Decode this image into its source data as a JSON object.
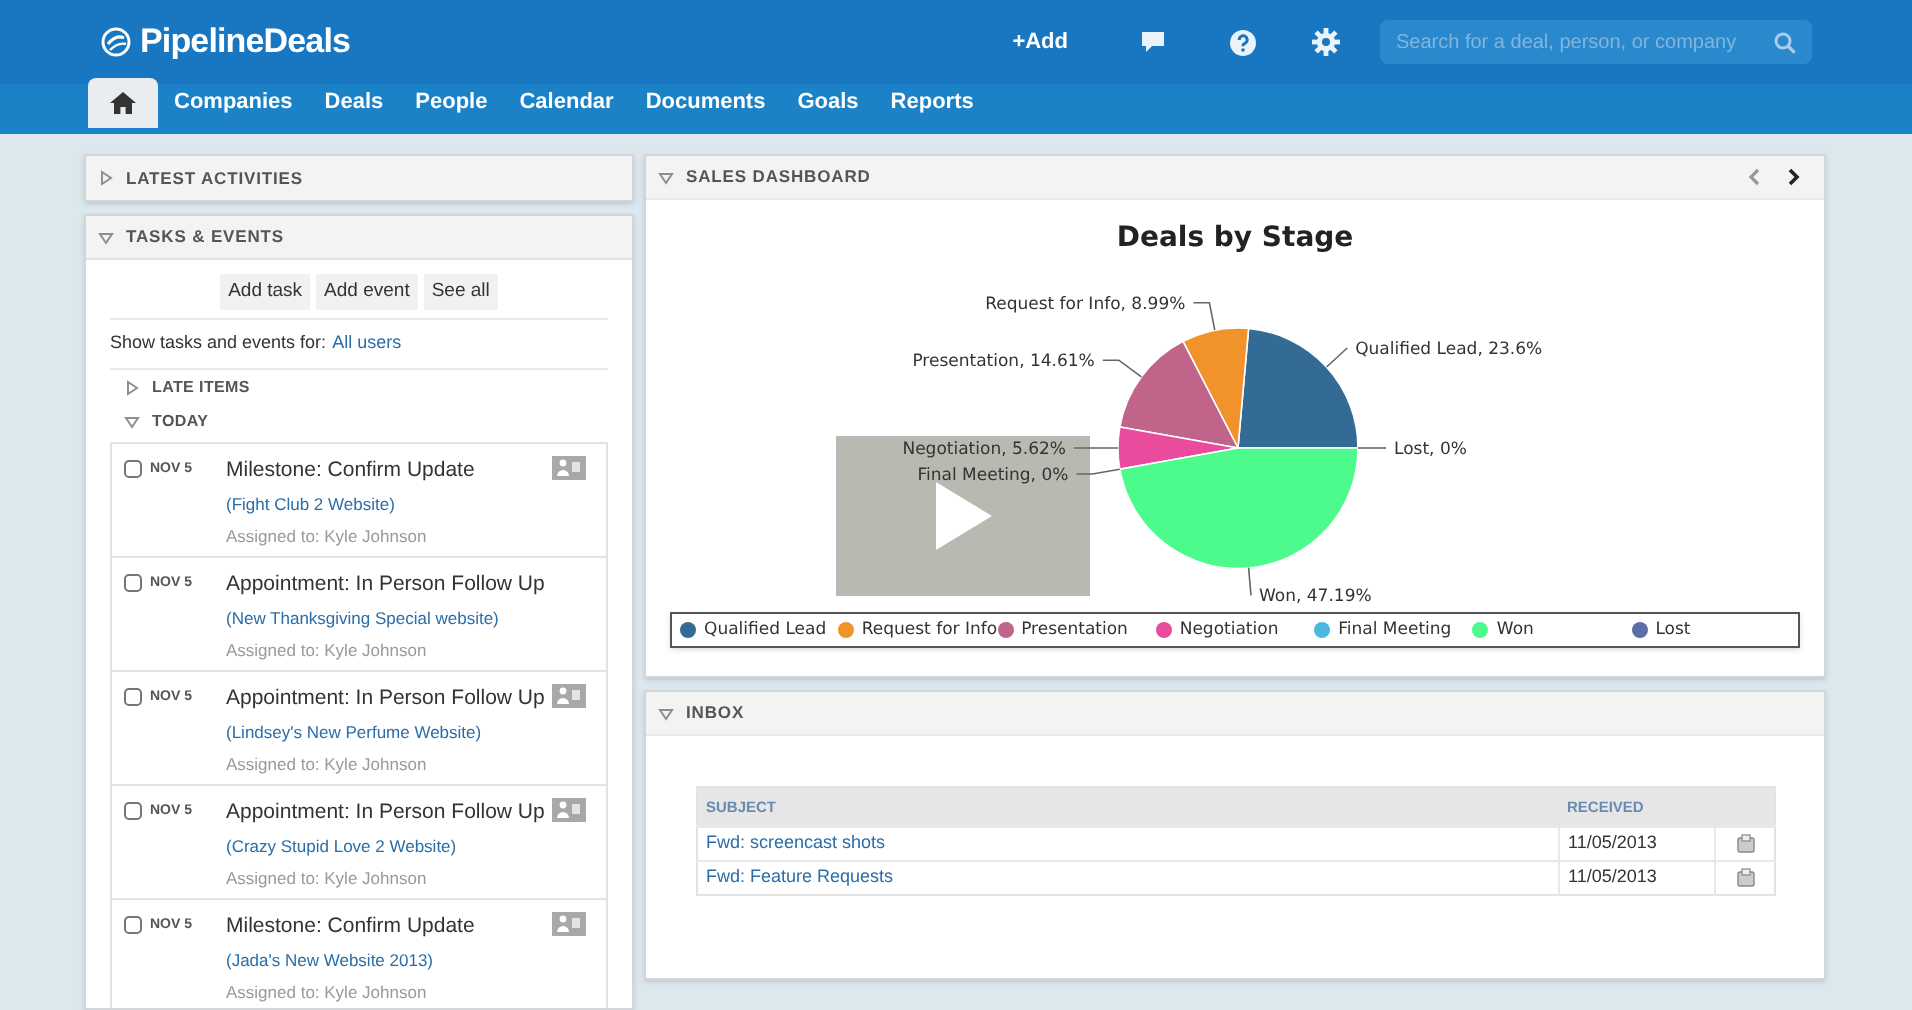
{
  "header": {
    "logo": "PipelineDeals",
    "add_button": "+Add",
    "search": {
      "placeholder": "Search for a deal, person, or company"
    }
  },
  "nav": [
    {
      "kind": "home",
      "selected": true
    },
    {
      "label": "Companies",
      "kind": "text",
      "selected": false
    },
    {
      "label": "Deals",
      "kind": "text",
      "selected": false
    },
    {
      "label": "People",
      "kind": "text",
      "selected": false
    },
    {
      "label": "Calendar",
      "kind": "text",
      "selected": false
    },
    {
      "label": "Documents",
      "kind": "text",
      "selected": false
    },
    {
      "label": "Goals",
      "kind": "text",
      "selected": false
    },
    {
      "label": "Reports",
      "kind": "text",
      "selected": false
    }
  ],
  "latest_activities": {
    "title": "LATEST ACTIVITIES",
    "expanded": false
  },
  "tasks_events": {
    "title": "TASKS & EVENTS",
    "expanded": true,
    "buttons": [
      "Add task",
      "Add event",
      "See all"
    ],
    "filter_label": "Show tasks and events for:",
    "filter_link": "All users",
    "groups": [
      {
        "title": "LATE ITEMS",
        "expanded": false
      },
      {
        "title": "TODAY",
        "expanded": true
      }
    ],
    "items": [
      {
        "checked": false,
        "date": "NOV 5",
        "title": "Milestone: Confirm Update",
        "deal": "(Fight Club 2 Website)",
        "assigned": "Assigned to: Kyle Johnson",
        "card_icon": true
      },
      {
        "checked": false,
        "date": "NOV 5",
        "title": "Appointment: In Person Follow Up",
        "deal": "(New Thanksgiving Special website)",
        "assigned": "Assigned to: Kyle Johnson",
        "card_icon": false
      },
      {
        "checked": false,
        "date": "NOV 5",
        "title": "Appointment: In Person Follow Up",
        "deal": "(Lindsey's New Perfume Website)",
        "assigned": "Assigned to: Kyle Johnson",
        "card_icon": true
      },
      {
        "checked": false,
        "date": "NOV 5",
        "title": "Appointment: In Person Follow Up",
        "deal": "(Crazy Stupid Love 2 Website)",
        "assigned": "Assigned to: Kyle Johnson",
        "card_icon": true
      },
      {
        "checked": false,
        "date": "NOV 5",
        "title": "Milestone: Confirm Update",
        "deal": "(Jada's New Website 2013)",
        "assigned": "Assigned to: Kyle Johnson",
        "card_icon": true
      }
    ]
  },
  "sales_dashboard": {
    "title": "SALES DASHBOARD",
    "expanded": true,
    "chart_data": {
      "type": "pie",
      "title": "Deals by Stage",
      "categories": [
        "Qualified Lead",
        "Request for Info",
        "Presentation",
        "Negotiation",
        "Final Meeting",
        "Won",
        "Lost"
      ],
      "values": [
        23.6,
        8.99,
        14.61,
        5.62,
        0,
        47.19,
        0
      ],
      "legend": true,
      "colors": [
        "#336b94",
        "#f0932a",
        "#c0648a",
        "#e94c9c",
        "#4ab8e0",
        "#4dfb8c",
        "#5a6fa8"
      ],
      "value_labels": [
        "Qualified Lead, 23.6%",
        "Request for Info, 8.99%",
        "Presentation, 14.61%",
        "Negotiation, 5.62%",
        "Final Meeting, 0%",
        "Won, 47.19%",
        "Lost, 0%"
      ]
    }
  },
  "inbox": {
    "title": "INBOX",
    "expanded": true,
    "columns": [
      "SUBJECT",
      "RECEIVED"
    ],
    "rows": [
      {
        "subject": "Fwd: screencast shots",
        "received": "11/05/2013"
      },
      {
        "subject": "Fwd: Feature Requests",
        "received": "11/05/2013"
      }
    ]
  }
}
